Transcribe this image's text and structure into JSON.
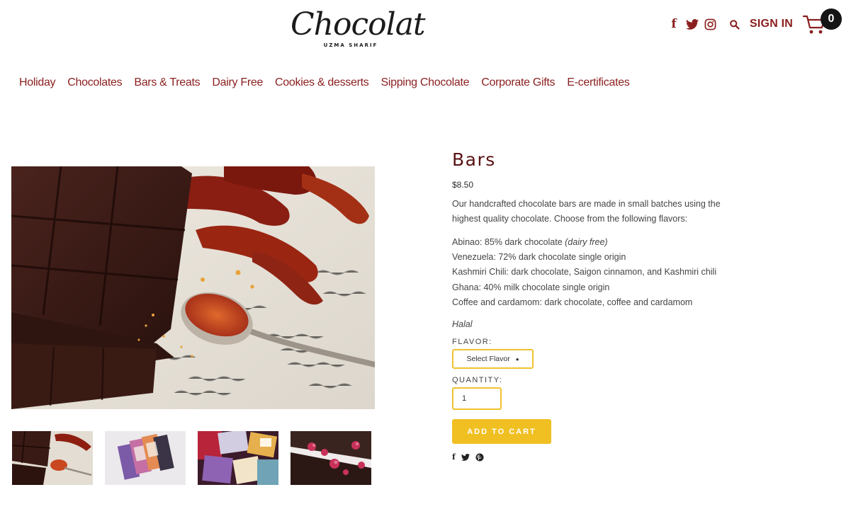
{
  "brand": {
    "name": "Chocolat",
    "tagline": "UZMA SHARIF"
  },
  "header": {
    "icons": [
      "facebook-icon",
      "twitter-icon",
      "instagram-icon",
      "search-icon"
    ],
    "signin_label": "SIGN IN",
    "cart_count": "0"
  },
  "nav": {
    "items": [
      {
        "label": "Holiday"
      },
      {
        "label": "Chocolates"
      },
      {
        "label": "Bars & Treats"
      },
      {
        "label": "Dairy Free"
      },
      {
        "label": "Cookies & desserts"
      },
      {
        "label": "Sipping Chocolate"
      },
      {
        "label": "Corporate Gifts"
      },
      {
        "label": "E-certificates"
      }
    ]
  },
  "product": {
    "title": "Bars",
    "price": "$8.50",
    "description": "Our handcrafted chocolate bars are made in small batches using the highest quality chocolate. Choose from the following flavors:",
    "flavors": [
      {
        "text": "Abinao: 85% dark chocolate ",
        "note": "(dairy free)"
      },
      {
        "text": "Venezuela: 72% dark chocolate single origin",
        "note": ""
      },
      {
        "text": "Kashmiri Chili: dark chocolate, Saigon cinnamon, and Kashmiri chili",
        "note": ""
      },
      {
        "text": "Ghana: 40% milk chocolate single origin",
        "note": ""
      },
      {
        "text": "Coffee and cardamom: dark chocolate, coffee and cardamom",
        "note": ""
      }
    ],
    "halal": "Halal",
    "flavor_label": "FLAVOR:",
    "flavor_select": "Select Flavor",
    "quantity_label": "QUANTITY:",
    "quantity_value": "1",
    "add_to_cart": "ADD TO CART"
  },
  "share": {
    "icons": [
      "facebook-icon",
      "twitter-icon",
      "pinterest-icon"
    ]
  },
  "colors": {
    "brand": "#8b1f1f",
    "title": "#5a1313",
    "accent": "#f0c022",
    "text": "#444444"
  }
}
